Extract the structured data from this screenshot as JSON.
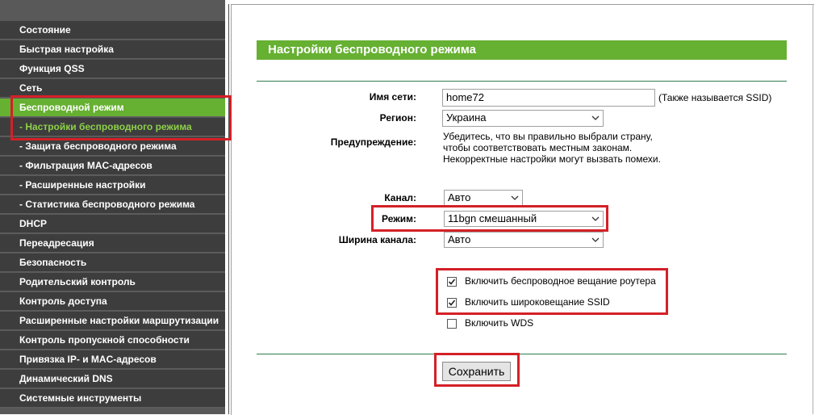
{
  "sidebar": {
    "items": [
      {
        "label": "Состояние"
      },
      {
        "label": "Быстрая настройка"
      },
      {
        "label": "Функция QSS"
      },
      {
        "label": "Сеть"
      },
      {
        "label": "Беспроводной режим"
      },
      {
        "label": "- Настройки беспроводного режима"
      },
      {
        "label": "- Защита беспроводного режима"
      },
      {
        "label": "- Фильтрация MAC-адресов"
      },
      {
        "label": "- Расширенные настройки"
      },
      {
        "label": "- Статистика беспроводного режима"
      },
      {
        "label": "DHCP"
      },
      {
        "label": "Переадресация"
      },
      {
        "label": "Безопасность"
      },
      {
        "label": "Родительский контроль"
      },
      {
        "label": "Контроль доступа"
      },
      {
        "label": "Расширенные настройки маршрутизации"
      },
      {
        "label": "Контроль пропускной способности"
      },
      {
        "label": "Привязка IP- и MAC-адресов"
      },
      {
        "label": "Динамический DNS"
      },
      {
        "label": "Системные инструменты"
      }
    ]
  },
  "main": {
    "title": "Настройки беспроводного режима",
    "ssid": {
      "label": "Имя сети:",
      "value": "home72",
      "note": "(Также называется SSID)"
    },
    "region": {
      "label": "Регион:",
      "value": "Украина"
    },
    "warning": {
      "label": "Предупреждение:",
      "lines": [
        "Убедитесь, что вы правильно выбрали страну,",
        "чтобы соответствовать местным законам.",
        "Некорректные настройки могут вызвать помехи."
      ]
    },
    "channel": {
      "label": "Канал:",
      "value": "Авто"
    },
    "mode": {
      "label": "Режим:",
      "value": "11bgn смешанный"
    },
    "width": {
      "label": "Ширина канала:",
      "value": "Авто"
    },
    "checkboxes": [
      {
        "label": "Включить беспроводное вещание роутера",
        "checked": true
      },
      {
        "label": "Включить широковещание SSID",
        "checked": true
      },
      {
        "label": "Включить WDS",
        "checked": false
      }
    ],
    "save_label": "Сохранить"
  },
  "colors": {
    "accent": "#66b032",
    "menu_bg": "#3d3d3d",
    "highlight": "#d42027"
  }
}
